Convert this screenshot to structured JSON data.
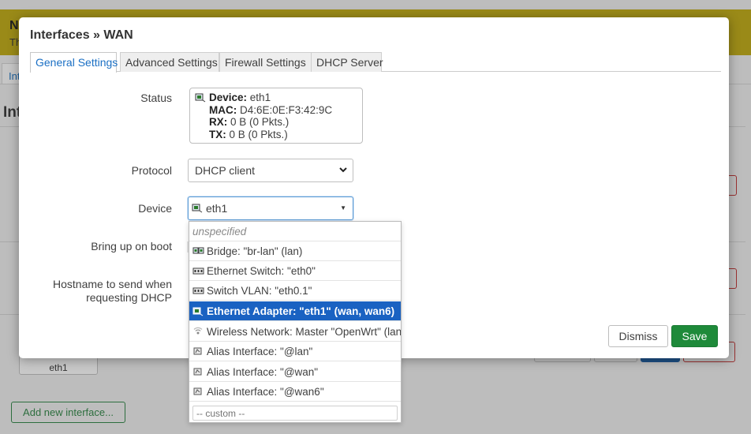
{
  "background": {
    "notice_title_fragment": "N",
    "notice_text_fragment": "Th",
    "tab_fragment": "Int",
    "heading_fragment": "Int",
    "device_label": "eth1",
    "add_button": "Add new interface..."
  },
  "modal": {
    "title": "Interfaces » WAN",
    "tabs": [
      {
        "label": "General Settings",
        "active": true
      },
      {
        "label": "Advanced Settings",
        "active": false
      },
      {
        "label": "Firewall Settings",
        "active": false
      },
      {
        "label": "DHCP Server",
        "active": false
      }
    ],
    "status": {
      "label": "Status",
      "device_key": "Device:",
      "device_val": "eth1",
      "mac_key": "MAC:",
      "mac_val": "D4:6E:0E:F3:42:9C",
      "rx_key": "RX:",
      "rx_val": "0 B (0 Pkts.)",
      "tx_key": "TX:",
      "tx_val": "0 B (0 Pkts.)"
    },
    "protocol": {
      "label": "Protocol",
      "value": "DHCP client"
    },
    "device": {
      "label": "Device",
      "value": "eth1"
    },
    "boot": {
      "label": "Bring up on boot"
    },
    "hostname": {
      "label_line1": "Hostname to send when",
      "label_line2": "requesting DHCP"
    },
    "dismiss": "Dismiss",
    "save": "Save"
  },
  "dropdown": {
    "items": [
      {
        "label": "unspecified",
        "icon": "none"
      },
      {
        "label": "Bridge: \"br-lan\" (lan)",
        "icon": "bridge-icon"
      },
      {
        "label": "Ethernet Switch: \"eth0\"",
        "icon": "switch-icon"
      },
      {
        "label": "Switch VLAN: \"eth0.1\"",
        "icon": "switch-icon"
      },
      {
        "label": "Ethernet Adapter: \"eth1\" (wan, wan6)",
        "icon": "ethernet-icon",
        "selected": true
      },
      {
        "label": "Wireless Network: Master \"OpenWrt\" (lan)",
        "icon": "wifi-icon"
      },
      {
        "label": "Alias Interface: \"@lan\"",
        "icon": "alias-icon"
      },
      {
        "label": "Alias Interface: \"@wan\"",
        "icon": "alias-icon"
      },
      {
        "label": "Alias Interface: \"@wan6\"",
        "icon": "alias-icon"
      }
    ],
    "custom_placeholder": "-- custom --"
  },
  "colors": {
    "accent": "#1a62c2",
    "save": "#1e8a3a",
    "tab_active": "#1a6fc4"
  }
}
